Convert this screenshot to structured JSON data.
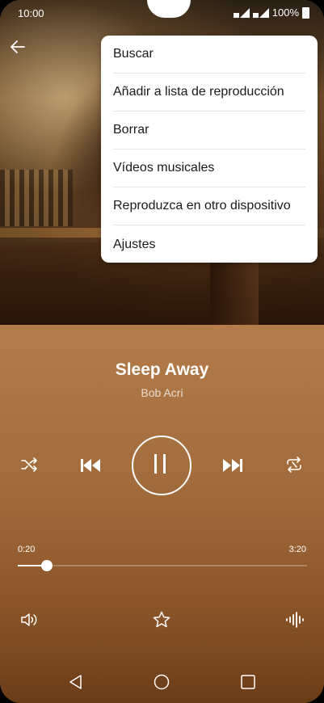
{
  "status": {
    "time": "10:00",
    "battery": "100%"
  },
  "menu": {
    "items": [
      {
        "label": "Buscar"
      },
      {
        "label": "Añadir a lista de reproducción"
      },
      {
        "label": "Borrar"
      },
      {
        "label": "Vídeos musicales"
      },
      {
        "label": "Reproduzca en otro dispositivo"
      },
      {
        "label": "Ajustes"
      }
    ]
  },
  "player": {
    "title": "Sleep Away",
    "artist": "Bob Acri",
    "elapsed": "0:20",
    "duration": "3:20",
    "progress": 0.1,
    "state": "playing"
  },
  "icons": {
    "back": "arrow-back-icon",
    "shuffle": "shuffle-icon",
    "previous": "skip-previous-icon",
    "pause": "pause-icon",
    "next": "skip-next-icon",
    "repeat": "repeat-icon",
    "volume": "volume-icon",
    "favorite": "star-icon",
    "equalizer": "equalizer-icon",
    "nav_back": "nav-back-icon",
    "nav_home": "nav-home-icon",
    "nav_recents": "nav-recents-icon"
  }
}
